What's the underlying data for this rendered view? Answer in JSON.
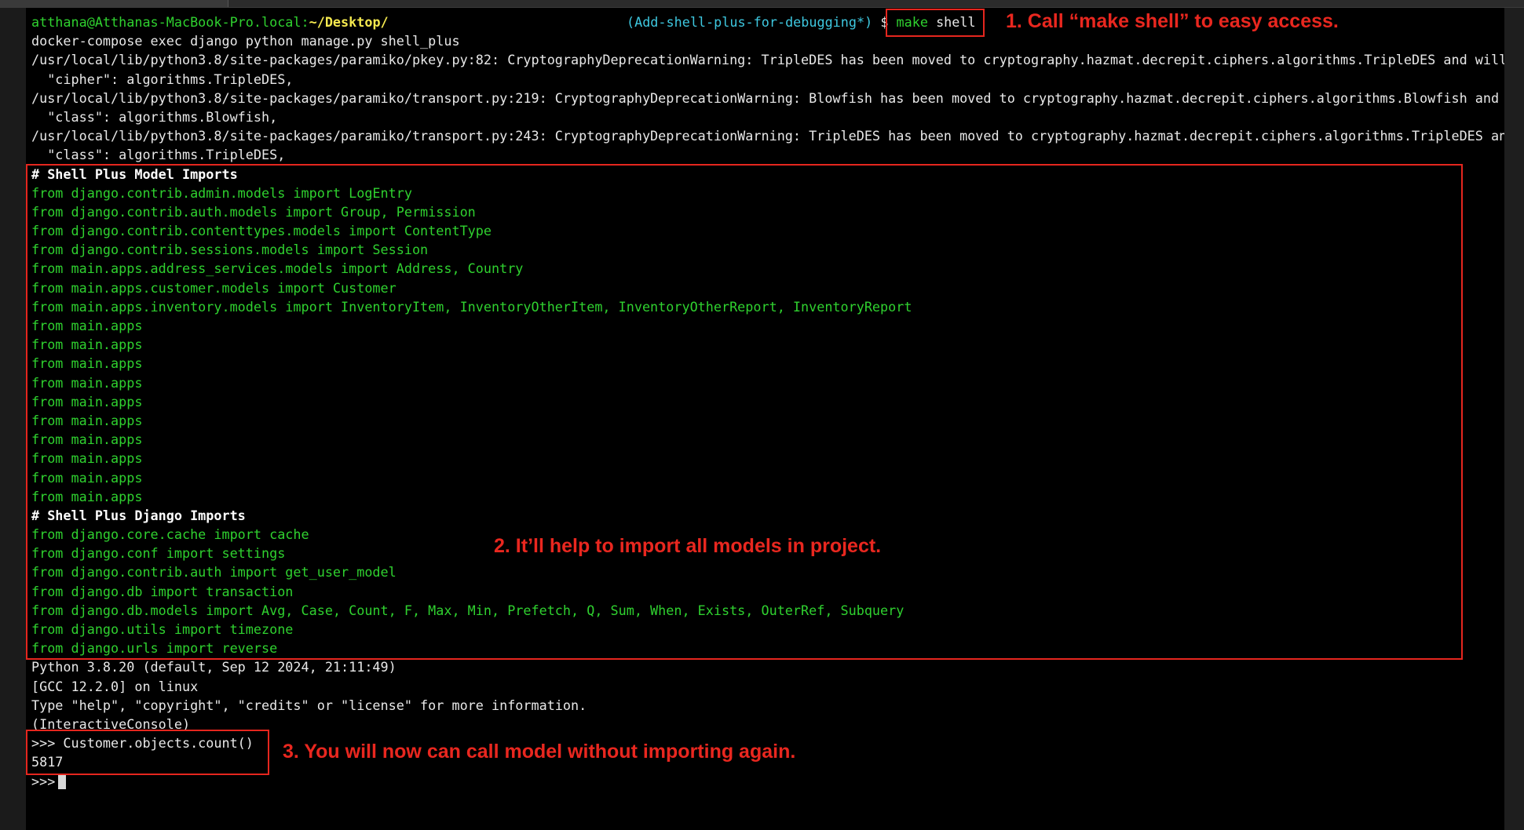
{
  "terminal": {
    "prompt": {
      "user_host": "atthana@Atthanas-MacBook-Pro.local:",
      "path": "~/Desktop/",
      "branch": "(Add-shell-plus-for-debugging*)",
      "dollar": "$",
      "cmd_make": "make",
      "cmd_shell": "shell"
    },
    "output_lines": [
      "docker-compose exec django python manage.py shell_plus",
      "/usr/local/lib/python3.8/site-packages/paramiko/pkey.py:82: CryptographyDeprecationWarning: TripleDES has been moved to cryptography.hazmat.decrepit.ciphers.algorithms.TripleDES and will be",
      "  \"cipher\": algorithms.TripleDES,",
      "/usr/local/lib/python3.8/site-packages/paramiko/transport.py:219: CryptographyDeprecationWarning: Blowfish has been moved to cryptography.hazmat.decrepit.ciphers.algorithms.Blowfish and wil",
      "  \"class\": algorithms.Blowfish,",
      "/usr/local/lib/python3.8/site-packages/paramiko/transport.py:243: CryptographyDeprecationWarning: TripleDES has been moved to cryptography.hazmat.decrepit.ciphers.algorithms.TripleDES and w",
      "  \"class\": algorithms.TripleDES,"
    ],
    "model_header": "# Shell Plus Model Imports",
    "model_imports": [
      "from django.contrib.admin.models import LogEntry",
      "from django.contrib.auth.models import Group, Permission",
      "from django.contrib.contenttypes.models import ContentType",
      "from django.contrib.sessions.models import Session",
      "from main.apps.address_services.models import Address, Country",
      "from main.apps.customer.models import Customer",
      "from main.apps.inventory.models import InventoryItem, InventoryOtherItem, InventoryOtherReport, InventoryReport",
      "from main.apps",
      "from main.apps",
      "from main.apps",
      "from main.apps",
      "from main.apps",
      "from main.apps",
      "from main.apps",
      "from main.apps",
      "from main.apps",
      "from main.apps"
    ],
    "django_header": "# Shell Plus Django Imports",
    "django_imports": [
      "from django.core.cache import cache",
      "from django.conf import settings",
      "from django.contrib.auth import get_user_model",
      "from django.db import transaction",
      "from django.db.models import Avg, Case, Count, F, Max, Min, Prefetch, Q, Sum, When, Exists, OuterRef, Subquery",
      "from django.utils import timezone",
      "from django.urls import reverse"
    ],
    "python_info": [
      "Python 3.8.20 (default, Sep 12 2024, 21:11:49)",
      "[GCC 12.2.0] on linux",
      "Type \"help\", \"copyright\", \"credits\" or \"license\" for more information.",
      "(InteractiveConsole)"
    ],
    "repl_command": ">>> Customer.objects.count()",
    "repl_result": "5817",
    "repl_prompt": ">>>"
  },
  "annotations": {
    "step1": "1. Call “make shell” to easy access.",
    "step2": "2. It’ll help to import all models in project.",
    "step3": "3. You will now can call model without importing again."
  },
  "colors": {
    "annotation_red": "#e9271f",
    "import_green": "#2fd12f",
    "path_yellow": "#f5e94f",
    "branch_cyan": "#3ec8e0"
  }
}
